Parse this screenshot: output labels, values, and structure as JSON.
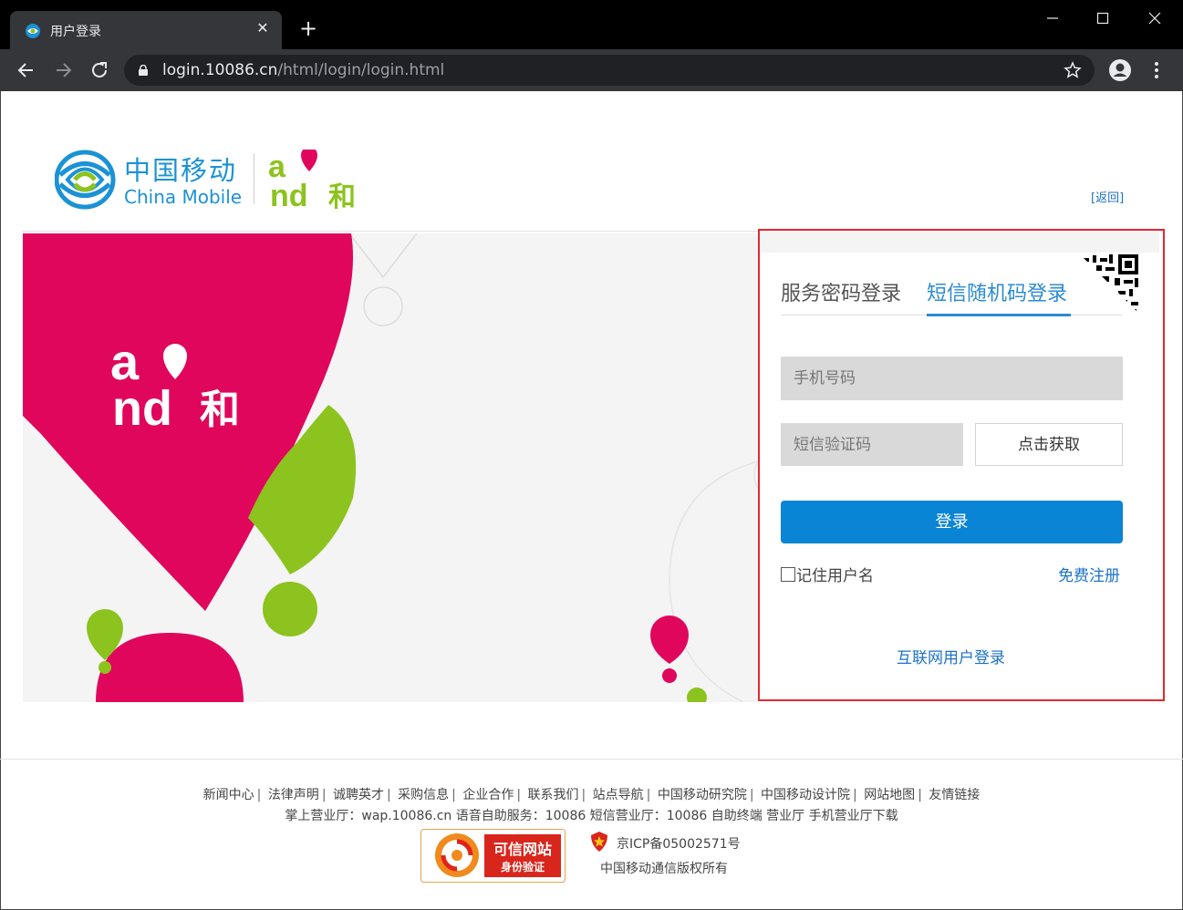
{
  "browser": {
    "tab_title": "用户登录",
    "tab_close": "✕",
    "new_tab": "+",
    "url_host": "login.10086.cn",
    "url_path": "/html/login/login.html"
  },
  "header": {
    "logo_cn": "中国移动",
    "logo_en": "China Mobile",
    "brand_and_letters": "and",
    "brand_he": "和",
    "back_link": "[返回]"
  },
  "banner": {
    "brand_letters": "and",
    "brand_he": "和"
  },
  "login": {
    "tab_password": "服务密码登录",
    "tab_sms": "短信随机码登录",
    "active_tab": "短信随机码登录",
    "phone_placeholder": "手机号码",
    "sms_placeholder": "短信验证码",
    "get_code_button": "点击获取",
    "login_button": "登录",
    "remember_label": "记住用户名",
    "remember_checked": false,
    "register_link": "免费注册",
    "internet_login_link": "互联网用户登录"
  },
  "footer": {
    "links": [
      "新闻中心",
      "法律声明",
      "诚聘英才",
      "采购信息",
      "企业合作",
      "联系我们",
      "站点导航",
      "中国移动研究院",
      "中国移动设计院",
      "网站地图",
      "友情链接"
    ],
    "services": "掌上营业厅：wap.10086.cn 语音自助服务：10086 短信营业厅：10086 自助终端 营业厅 手机营业厅下载",
    "trust_badge_line1": "可信网站",
    "trust_badge_line2": "身份验证",
    "icp": "京ICP备05002571号",
    "copyright": "中国移动通信版权所有"
  },
  "colors": {
    "accent_blue": "#0a84d4",
    "link_blue": "#1b72c8",
    "brand_pink": "#e0065c",
    "brand_green": "#8cc31e",
    "highlight_red": "#e02a32"
  }
}
